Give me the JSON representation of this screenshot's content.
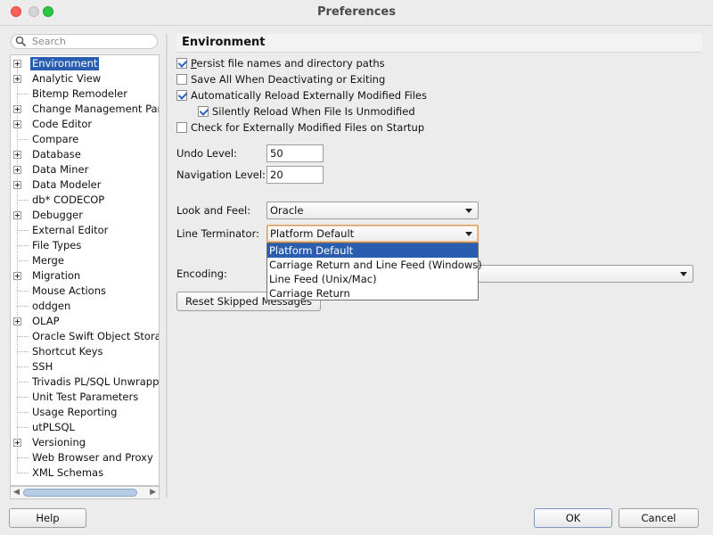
{
  "window": {
    "title": "Preferences"
  },
  "search": {
    "placeholder": "Search"
  },
  "tree": {
    "items": [
      {
        "label": "Environment",
        "expandable": true,
        "selected": true
      },
      {
        "label": "Analytic View",
        "expandable": true
      },
      {
        "label": "Bitemp Remodeler",
        "expandable": false
      },
      {
        "label": "Change Management Param",
        "expandable": true
      },
      {
        "label": "Code Editor",
        "expandable": true
      },
      {
        "label": "Compare",
        "expandable": false
      },
      {
        "label": "Database",
        "expandable": true
      },
      {
        "label": "Data Miner",
        "expandable": true
      },
      {
        "label": "Data Modeler",
        "expandable": true
      },
      {
        "label": "db* CODECOP",
        "expandable": false
      },
      {
        "label": "Debugger",
        "expandable": true
      },
      {
        "label": "External Editor",
        "expandable": false
      },
      {
        "label": "File Types",
        "expandable": false
      },
      {
        "label": "Merge",
        "expandable": false
      },
      {
        "label": "Migration",
        "expandable": true
      },
      {
        "label": "Mouse Actions",
        "expandable": false
      },
      {
        "label": "oddgen",
        "expandable": false
      },
      {
        "label": "OLAP",
        "expandable": true
      },
      {
        "label": "Oracle Swift Object Storage",
        "expandable": false
      },
      {
        "label": "Shortcut Keys",
        "expandable": false
      },
      {
        "label": "SSH",
        "expandable": false
      },
      {
        "label": "Trivadis PL/SQL Unwrapper",
        "expandable": false
      },
      {
        "label": "Unit Test Parameters",
        "expandable": false
      },
      {
        "label": "Usage Reporting",
        "expandable": false
      },
      {
        "label": "utPLSQL",
        "expandable": false
      },
      {
        "label": "Versioning",
        "expandable": true
      },
      {
        "label": "Web Browser and Proxy",
        "expandable": false
      },
      {
        "label": "XML Schemas",
        "expandable": false
      }
    ]
  },
  "panel": {
    "title": "Environment",
    "checkboxes": {
      "persist": {
        "label": "Persist file names and directory paths",
        "checked": true
      },
      "save_all": {
        "label": "Save All When Deactivating or Exiting",
        "checked": false
      },
      "auto_reload": {
        "label": "Automatically Reload Externally Modified Files",
        "checked": true
      },
      "silent_reload": {
        "label": "Silently Reload When File Is Unmodified",
        "checked": true
      },
      "check_startup": {
        "label": "Check for Externally Modified Files on Startup",
        "checked": false
      }
    },
    "undo_level": {
      "label": "Undo Level:",
      "value": "50"
    },
    "navigation_level": {
      "label": "Navigation Level:",
      "value": "20"
    },
    "look_and_feel": {
      "label": "Look and Feel:",
      "value": "Oracle"
    },
    "line_terminator": {
      "label": "Line Terminator:",
      "value": "Platform Default",
      "options": [
        "Platform Default",
        "Carriage Return and Line Feed (Windows)",
        "Line Feed (Unix/Mac)",
        "Carriage Return"
      ]
    },
    "encoding": {
      "label": "Encoding:"
    },
    "reset_button": {
      "label": "Reset Skipped Messages"
    }
  },
  "footer": {
    "help": "Help",
    "ok": "OK",
    "cancel": "Cancel"
  },
  "colors": {
    "selection": "#2a5db0",
    "close": "#fe5f57",
    "maximize": "#28c840",
    "check": "#2b62b8"
  }
}
